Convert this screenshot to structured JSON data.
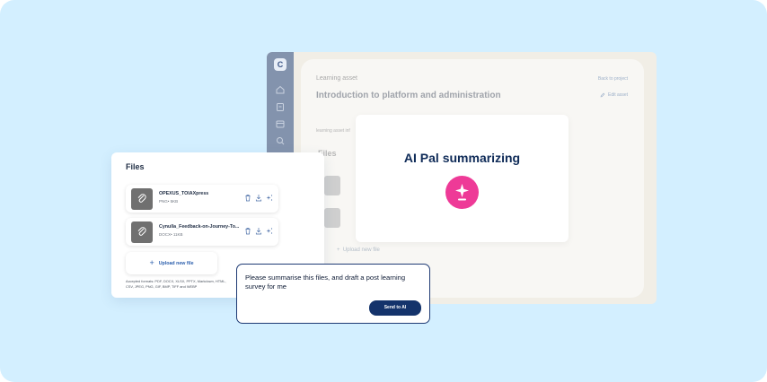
{
  "app": {
    "logo": "C",
    "breadcrumb": "Learning asset",
    "back_link": "Back to project",
    "title": "Introduction to platform and administration",
    "edit_label": "Edit asset",
    "tab_label": "learning asset inf",
    "files_heading": "Files",
    "upload_label": "Upload new file"
  },
  "modal": {
    "title": "AI Pal summarizing",
    "badge_color": "#ee3a97"
  },
  "files_card": {
    "title": "Files",
    "files": [
      {
        "name": "OPEXUS_TOIAXpress",
        "meta": "PNG• 5KB"
      },
      {
        "name": "Cynulla_Feedback-on-Journey-To...",
        "meta": "DOCX• 11KB"
      }
    ],
    "upload_label": "Upload new file",
    "accepted_formats": "Accepted formats: PDF, DOCX, XLSX, PPTX, Markdown, HTML, CSV, JPEG, PNG, GIF, BMP, TIFF and WEBP"
  },
  "prompt": {
    "text": "Please summarise this files, and draft a post learning survey for me",
    "send_label": "Send to AI"
  },
  "colors": {
    "background": "#d3efff",
    "accent": "#14336b",
    "link": "#2c5fad"
  }
}
